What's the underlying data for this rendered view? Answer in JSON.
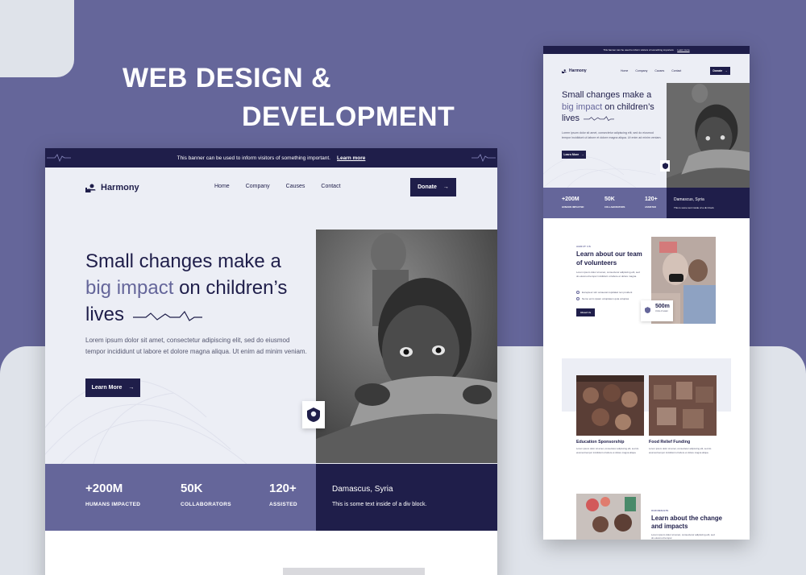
{
  "colors": {
    "primary_dark": "#1f1e4a",
    "accent_purple": "#65669a",
    "hero_bg": "#eceef5",
    "page_bg": "#65669a"
  },
  "headline": {
    "line1": "WEB DESIGN &",
    "line2": "DEVELOPMENT"
  },
  "site": {
    "banner_text": "This banner can be used to inform visitors of something important.",
    "banner_link": "Learn more",
    "brand": "Harmony",
    "nav": [
      "Home",
      "Company",
      "Causes",
      "Contact"
    ],
    "donate_label": "Donate",
    "hero": {
      "title_pre": "Small changes make a",
      "title_highlight": "big impact",
      "title_mid": "on children’s",
      "title_end": "lives",
      "paragraph": "Lorem ipsum dolor sit amet, consectetur adipiscing elit, sed do eiusmod tempor incididunt ut labore et dolore magna aliqua. Ut enim ad minim veniam.",
      "cta": "Learn More"
    },
    "stats": [
      {
        "value": "+200M",
        "label": "HUMANS IMPACTED"
      },
      {
        "value": "50K",
        "label": "COLLABORATORS"
      },
      {
        "value": "120+",
        "label": "ASSISTED"
      }
    ],
    "location": {
      "title": "Damascus, Syria",
      "text": "This is some text inside of a div block."
    },
    "about": {
      "eyebrow": "ABOUT US",
      "title": "Learn about our team of volunteers",
      "text": "Lorem ipsum dolor sit amet, consectetur adipiscing elit, sed do eiusmod tempor incididunt ut labore et dolore magna.",
      "checks": [
        "Excepteur sint occaecat cupidatat non proident",
        "Nemo enim ipsam voluptatem quia voluptas"
      ],
      "button": "About Us",
      "volunteers_value": "500m",
      "volunteers_label": "Units of water"
    },
    "causes": [
      {
        "title": "Education Sponsorship",
        "text": "Lorem ipsum dolor sit amet, consectetur adipiscing elit, sed do eiusmod tempor incididunt ut labore et dolore magna aliqua."
      },
      {
        "title": "Food Relief Funding",
        "text": "Lorem ipsum dolor sit amet, consectetur adipiscing elit, sed do eiusmod tempor incididunt ut labore et dolore magna aliqua."
      }
    ],
    "results": {
      "eyebrow": "OUR RESULTS",
      "title": "Learn about the change and impacts",
      "text": "Lorem ipsum dolor sit amet, consectetur adipiscing elit, sed do eiusmod tempor."
    }
  },
  "icons": {
    "brand": "hand-heart-icon",
    "arrow": "arrow-right-icon",
    "badge": "profile-badge-icon",
    "check": "check-circle-icon"
  }
}
